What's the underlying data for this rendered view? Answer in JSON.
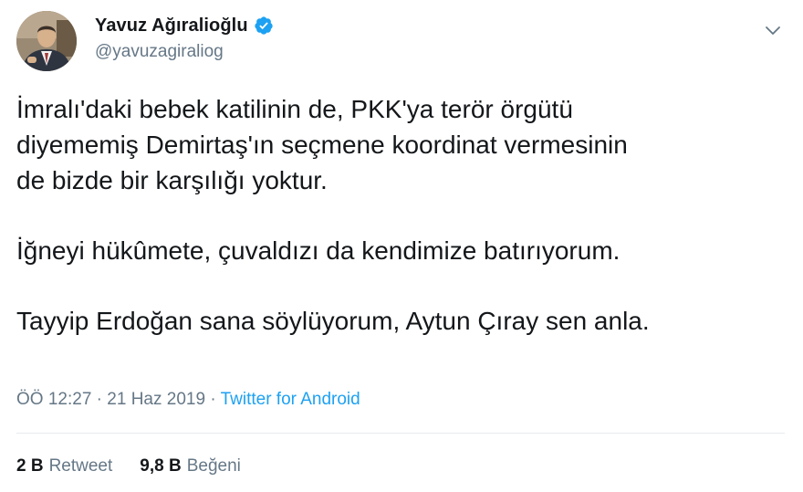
{
  "author": {
    "display_name": "Yavuz Ağıralioğlu",
    "handle": "@yavuzagiraliog",
    "verified": true
  },
  "tweet": {
    "paragraphs": [
      [
        "İmralı'daki bebek katilinin de, PKK'ya terör örgütü",
        "diyememiş Demirtaş'ın seçmene koordinat vermesinin",
        "de bizde bir karşılığı yoktur."
      ],
      [
        "İğneyi hükûmete, çuvaldızı da kendimize batırıyorum."
      ],
      [
        "Tayyip Erdoğan sana söylüyorum, Aytun Çıray sen anla."
      ]
    ],
    "time": "ÖÖ 12:27",
    "separator": "·",
    "date": "21 Haz 2019",
    "source": "Twitter for Android"
  },
  "stats": {
    "retweets_count": "2 B",
    "retweets_label": "Retweet",
    "likes_count": "9,8 B",
    "likes_label": "Beğeni"
  },
  "icons": {
    "verified": "verified-badge-icon",
    "menu": "chevron-down-icon"
  },
  "colors": {
    "text": "#14171a",
    "secondary": "#657786",
    "accent": "#1da1f2",
    "divider": "#e6ecf0"
  }
}
